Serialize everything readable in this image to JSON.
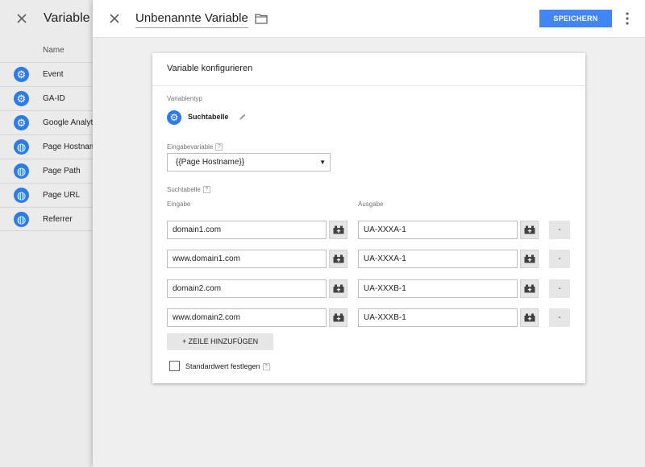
{
  "background": {
    "title": "Variable a",
    "column_header": "Name",
    "items": [
      {
        "label": "Event",
        "icon": "gear-icon"
      },
      {
        "label": "GA-ID",
        "icon": "gear-icon"
      },
      {
        "label": "Google Analyt",
        "icon": "gear-icon"
      },
      {
        "label": "Page Hostnam",
        "icon": "globe-icon"
      },
      {
        "label": "Page Path",
        "icon": "globe-icon"
      },
      {
        "label": "Page URL",
        "icon": "globe-icon"
      },
      {
        "label": "Referrer",
        "icon": "globe-icon"
      }
    ]
  },
  "header": {
    "title": "Unbenannte Variable",
    "save_label": "SPEICHERN"
  },
  "card": {
    "title": "Variable konfigurieren",
    "type_label": "Variablentyp",
    "type_name": "Suchtabelle",
    "input_var_label": "Eingabevariable",
    "input_var_value": "{{Page Hostname}}",
    "table_label": "Suchtabelle",
    "col_input": "Eingabe",
    "col_output": "Ausgabe",
    "rows": [
      {
        "input": "domain1.com",
        "output": "UA-XXXA-1",
        "remove": "-"
      },
      {
        "input": "www.domain1.com",
        "output": "UA-XXXA-1",
        "remove": "-"
      },
      {
        "input": "domain2.com",
        "output": "UA-XXXB-1",
        "remove": "-"
      },
      {
        "input": "www.domain2.com",
        "output": "UA-XXXB-1",
        "remove": "-"
      }
    ],
    "add_row_label": "+ ZEILE HINZUFÜGEN",
    "default_label": "Standardwert festlegen",
    "help_glyph": "?"
  },
  "colors": {
    "accent": "#4285f4",
    "icon_blue": "#2f7be6"
  }
}
